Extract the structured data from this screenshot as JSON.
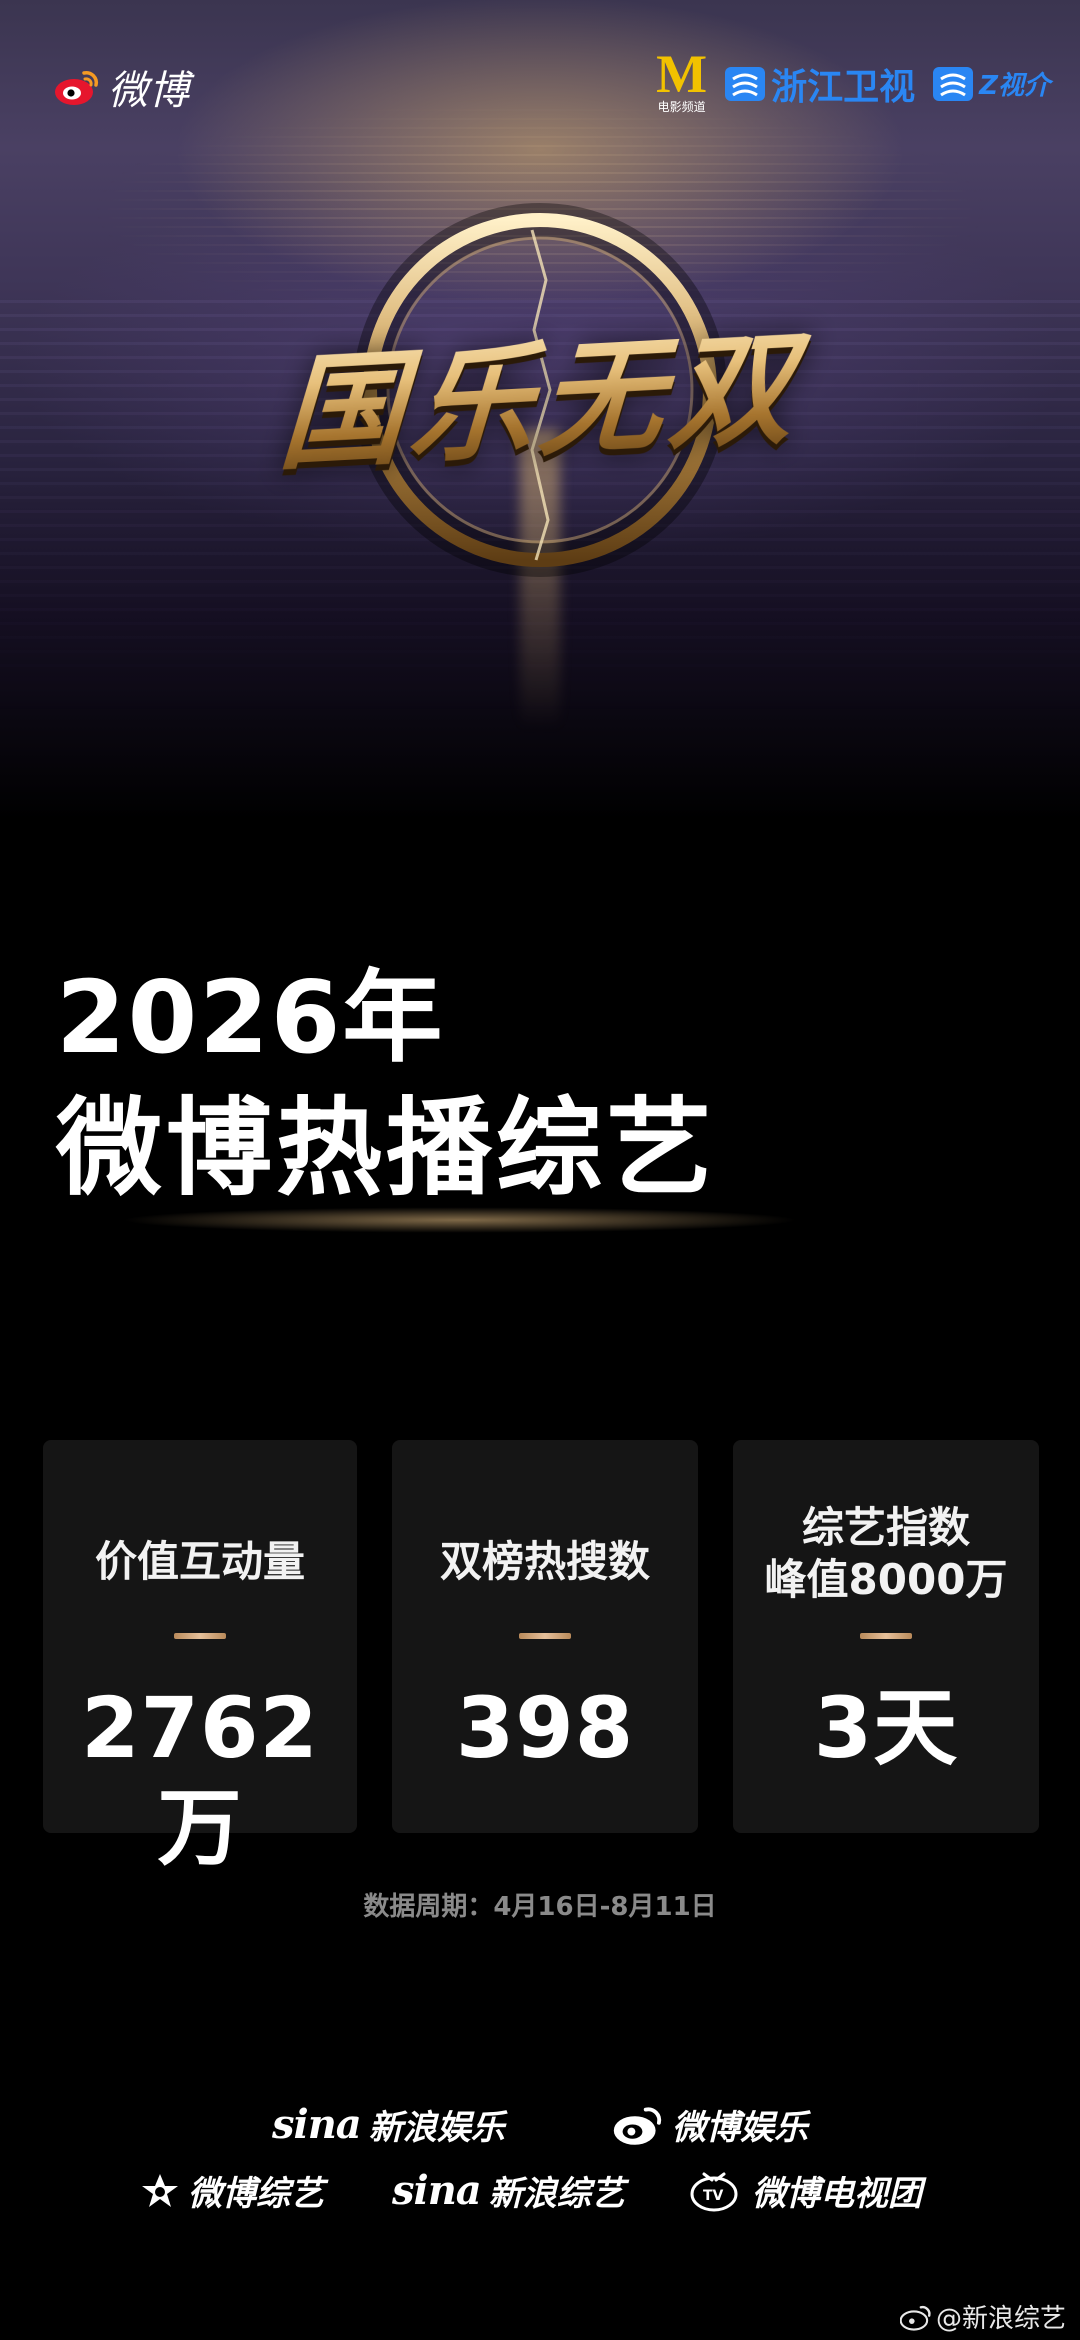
{
  "header": {
    "brand_text": "微博",
    "partner_logos": {
      "m_letter": "M",
      "m_caption": "电影频道",
      "zhejiang_tv": "浙江卫视",
      "z_video": "Z视介"
    }
  },
  "hero": {
    "show_title": "国乐无双"
  },
  "title": {
    "year": "2026年",
    "main": "微博热播综艺"
  },
  "stats": [
    {
      "label_line1": "价值互动量",
      "label_line2": "",
      "value": "2762万"
    },
    {
      "label_line1": "双榜热搜数",
      "label_line2": "",
      "value": "398"
    },
    {
      "label_line1": "综艺指数",
      "label_line2": "峰值8000万",
      "value": "3天"
    }
  ],
  "period": "数据周期：4月16日-8月11日",
  "footer": {
    "sina_ent": {
      "mark": "sina",
      "text": "新浪娱乐"
    },
    "weibo_ent": {
      "text": "微博娱乐"
    },
    "weibo_variety": {
      "text": "微博综艺"
    },
    "sina_variety": {
      "mark": "sina",
      "text": "新浪综艺"
    },
    "weibo_tv": {
      "text": "微博电视团"
    }
  },
  "watermark": "@新浪综艺",
  "colors": {
    "background": "#000000",
    "card": "#151515",
    "divider": "#d7ad84",
    "emblem_gold": "#e7c07b",
    "m_logo": "#f2c200",
    "zhejiang_blue": "#2a86f3",
    "weibo_red": "#e6162d"
  }
}
